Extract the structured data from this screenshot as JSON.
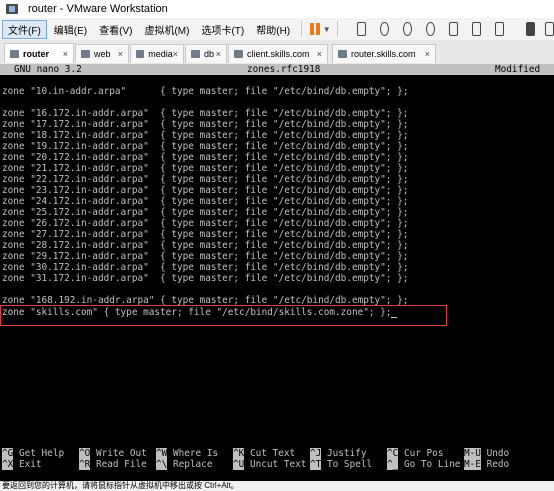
{
  "window": {
    "title": "router - VMware Workstation"
  },
  "menubar": {
    "items": [
      "文件(F)",
      "编辑(E)",
      "查看(V)",
      "虚拟机(M)",
      "选项卡(T)",
      "帮助(H)"
    ]
  },
  "tabs": [
    {
      "label": "router",
      "active": true
    },
    {
      "label": "web",
      "active": false
    },
    {
      "label": "media",
      "active": false
    },
    {
      "label": "db",
      "active": false
    },
    {
      "label": "client.skills.com",
      "active": false
    },
    {
      "label": "router.skills.com",
      "active": false
    }
  ],
  "nano": {
    "version": "GNU nano 3.2",
    "filename": "zones.rfc1918",
    "status": "Modified",
    "lines": [
      "zone \"10.in-addr.arpa\"      { type master; file \"/etc/bind/db.empty\"; };",
      "",
      "zone \"16.172.in-addr.arpa\"  { type master; file \"/etc/bind/db.empty\"; };",
      "zone \"17.172.in-addr.arpa\"  { type master; file \"/etc/bind/db.empty\"; };",
      "zone \"18.172.in-addr.arpa\"  { type master; file \"/etc/bind/db.empty\"; };",
      "zone \"19.172.in-addr.arpa\"  { type master; file \"/etc/bind/db.empty\"; };",
      "zone \"20.172.in-addr.arpa\"  { type master; file \"/etc/bind/db.empty\"; };",
      "zone \"21.172.in-addr.arpa\"  { type master; file \"/etc/bind/db.empty\"; };",
      "zone \"22.172.in-addr.arpa\"  { type master; file \"/etc/bind/db.empty\"; };",
      "zone \"23.172.in-addr.arpa\"  { type master; file \"/etc/bind/db.empty\"; };",
      "zone \"24.172.in-addr.arpa\"  { type master; file \"/etc/bind/db.empty\"; };",
      "zone \"25.172.in-addr.arpa\"  { type master; file \"/etc/bind/db.empty\"; };",
      "zone \"26.172.in-addr.arpa\"  { type master; file \"/etc/bind/db.empty\"; };",
      "zone \"27.172.in-addr.arpa\"  { type master; file \"/etc/bind/db.empty\"; };",
      "zone \"28.172.in-addr.arpa\"  { type master; file \"/etc/bind/db.empty\"; };",
      "zone \"29.172.in-addr.arpa\"  { type master; file \"/etc/bind/db.empty\"; };",
      "zone \"30.172.in-addr.arpa\"  { type master; file \"/etc/bind/db.empty\"; };",
      "zone \"31.172.in-addr.arpa\"  { type master; file \"/etc/bind/db.empty\"; };",
      "",
      "zone \"168.192.in-addr.arpa\" { type master; file \"/etc/bind/db.empty\"; };",
      "zone \"skills.com\" { type master; file \"/etc/bind/skills.com.zone\"; };"
    ]
  },
  "shortcuts": {
    "row1": [
      {
        "key": "^G",
        "label": "Get Help"
      },
      {
        "key": "^O",
        "label": "Write Out"
      },
      {
        "key": "^W",
        "label": "Where Is"
      },
      {
        "key": "^K",
        "label": "Cut Text"
      },
      {
        "key": "^J",
        "label": "Justify"
      },
      {
        "key": "^C",
        "label": "Cur Pos"
      },
      {
        "key": "M-U",
        "label": "Undo"
      }
    ],
    "row2": [
      {
        "key": "^X",
        "label": "Exit"
      },
      {
        "key": "^R",
        "label": "Read File"
      },
      {
        "key": "^\\",
        "label": "Replace"
      },
      {
        "key": "^U",
        "label": "Uncut Text"
      },
      {
        "key": "^T",
        "label": "To Spell"
      },
      {
        "key": "^_",
        "label": "Go To Line"
      },
      {
        "key": "M-E",
        "label": "Redo"
      }
    ]
  },
  "statusbar": {
    "text": "要返回到您的计算机，请将鼠标指针从虚拟机中移出或按 Ctrl+Alt。"
  },
  "colors": {
    "highlight": "#d94343",
    "pause": "#f07a1a",
    "console_bg": "#000000",
    "console_fg": "#c0c0c0"
  },
  "icons": [
    "vmware-app-icon",
    "pause-icon",
    "snapshot-icon",
    "revert-icon",
    "manage-snapshots-icon",
    "fullscreen-icon",
    "unity-icon",
    "console-icon",
    "view-icon"
  ]
}
